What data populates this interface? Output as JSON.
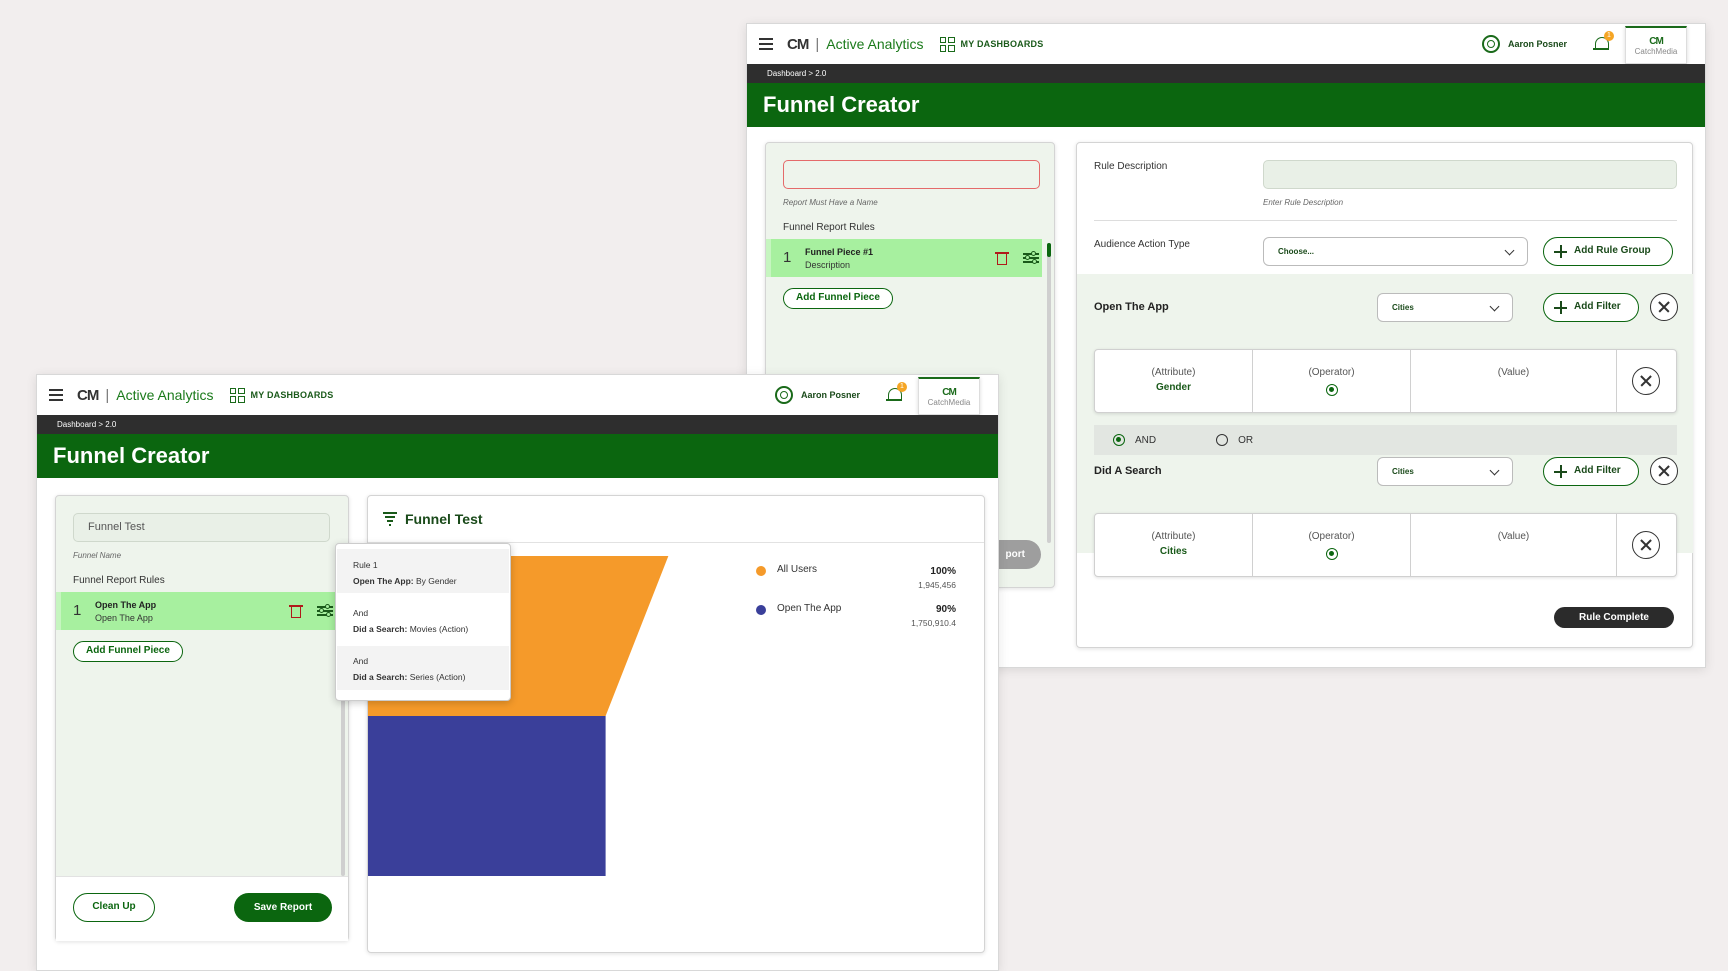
{
  "colors": {
    "brand_green": "#0b660f",
    "orange": "#f59a2a",
    "indigo": "#3a3f9a",
    "badge": "#f5a524",
    "rule_row": "#a7f09f"
  },
  "windows": {
    "back": {
      "topbar": {
        "logo": "CM",
        "app_title": "Active Analytics",
        "dashboards": "MY DASHBOARDS",
        "user": "Aaron Posner",
        "notifications": "1",
        "brand_card": "CatchMedia"
      },
      "breadcrumb": "Dashboard > 2.0",
      "header": "Funnel Creator",
      "left_panel": {
        "name_value": "",
        "name_helper": "Report Must Have a Name",
        "rules_label": "Funnel Report Rules",
        "rules": [
          {
            "num": "1",
            "title": "Funnel Piece #1",
            "subtitle": "Description"
          }
        ],
        "add_piece": "Add Funnel Piece"
      },
      "right_panel": {
        "rule_desc_label": "Rule Description",
        "rule_desc_helper": "Enter Rule Description",
        "audience_label": "Audience Action Type",
        "audience_value": "Choose...",
        "add_rule_group": "Add Rule Group",
        "groups": [
          {
            "title": "Open The App",
            "select": "Cities",
            "add_filter": "Add Filter",
            "filter": {
              "attribute": "(Attribute)",
              "attribute_value": "Gender",
              "operator": "(Operator)",
              "value": "(Value)"
            }
          },
          {
            "title": "Did A Search",
            "select": "Cities",
            "add_filter": "Add Filter",
            "filter": {
              "attribute": "(Attribute)",
              "attribute_value": "Cities",
              "operator": "(Operator)",
              "value": "(Value)"
            }
          }
        ],
        "and_label": "AND",
        "or_label": "OR",
        "rule_complete": "Rule Complete"
      },
      "hidden_button_partial": "port"
    },
    "front": {
      "topbar": {
        "logo": "CM",
        "app_title": "Active Analytics",
        "dashboards": "MY DASHBOARDS",
        "user": "Aaron Posner",
        "notifications": "1",
        "brand_card": "CatchMedia"
      },
      "breadcrumb": "Dashboard > 2.0",
      "header": "Funnel Creator",
      "left_panel": {
        "name_value": "Funnel Test",
        "name_helper": "Funnel Name",
        "rules_label": "Funnel Report Rules",
        "rules": [
          {
            "num": "1",
            "title": "Open The App",
            "subtitle": "Open The App"
          }
        ],
        "add_piece": "Add Funnel Piece",
        "clean_up": "Clean Up",
        "save_report": "Save Report"
      },
      "chart_panel": {
        "title": "Funnel Test",
        "tooltip": [
          {
            "head": "Rule 1",
            "bold": "Open The App:",
            "rest": " By Gender"
          },
          {
            "head": "And",
            "bold": "Did a Search:",
            "rest": " Movies (Action)"
          },
          {
            "head": "And",
            "bold": "Did a Search:",
            "rest": " Series (Action)"
          }
        ]
      }
    }
  },
  "chart_data": {
    "type": "bar",
    "categories": [
      "All Users",
      "Open The App"
    ],
    "series": [
      {
        "values": [
          1945456,
          1750910.4
        ]
      }
    ],
    "percent": [
      "100%",
      "90%"
    ],
    "counts": [
      "1,945,456",
      "1,750,910.4"
    ],
    "colors": [
      "#f59a2a",
      "#3a3f9a"
    ]
  }
}
